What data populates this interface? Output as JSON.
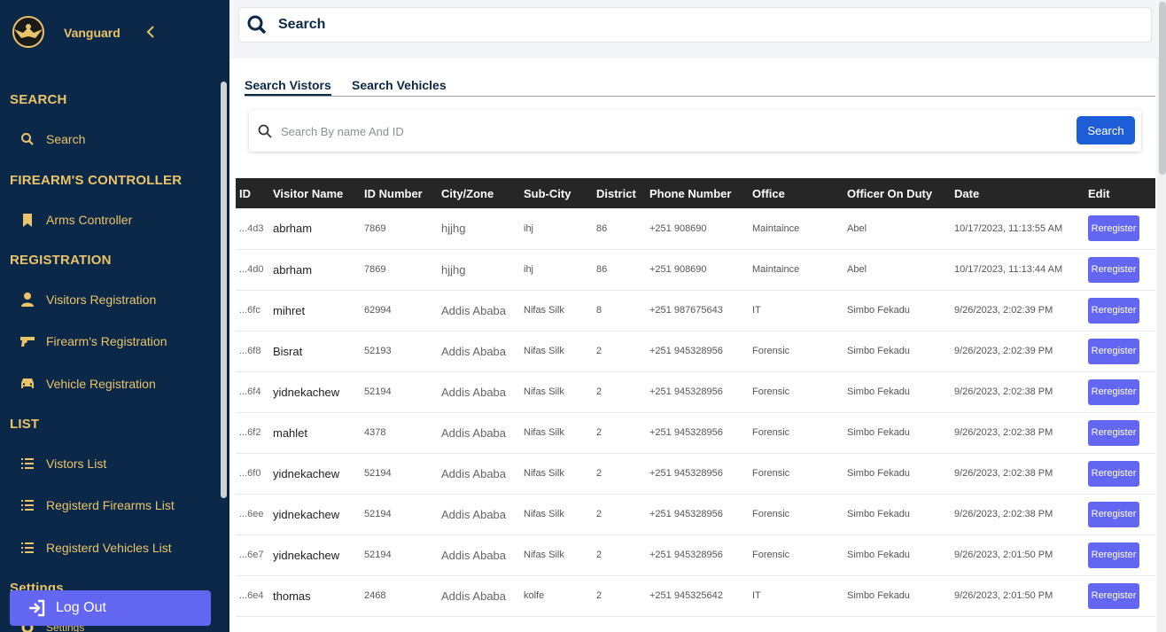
{
  "sidebar": {
    "brand": "Vanguard",
    "sections": [
      {
        "label": "SEARCH",
        "items": [
          {
            "label": "Search",
            "icon": "search-icon"
          }
        ]
      },
      {
        "label": "FIREARM'S CONTROLLER",
        "items": [
          {
            "label": "Arms Controller",
            "icon": "bookmark-icon"
          }
        ]
      },
      {
        "label": "REGISTRATION",
        "items": [
          {
            "label": "Visitors Registration",
            "icon": "user-icon"
          },
          {
            "label": "Firearm's Registration",
            "icon": "gun-icon"
          },
          {
            "label": "Vehicle Registration",
            "icon": "car-icon"
          }
        ]
      },
      {
        "label": "LIST",
        "items": [
          {
            "label": "Vistors List",
            "icon": "list-icon"
          },
          {
            "label": "Registerd Firearms List",
            "icon": "list-icon"
          },
          {
            "label": "Registerd Vehicles List",
            "icon": "list-icon"
          }
        ]
      },
      {
        "label": "Settings",
        "items": [
          {
            "label": "Settings",
            "icon": "gear-icon"
          }
        ]
      }
    ],
    "logout_label": "Log Out"
  },
  "top_search": {
    "label": "Search"
  },
  "tabs": [
    {
      "label": "Search Vistors",
      "active": true
    },
    {
      "label": "Search Vehicles",
      "active": false
    }
  ],
  "search": {
    "placeholder": "Search By name And ID",
    "button_label": "Search"
  },
  "table": {
    "headers": [
      "ID",
      "Visitor Name",
      "ID Number",
      "City/Zone",
      "Sub-City",
      "District",
      "Phone Number",
      "Office",
      "Officer On Duty",
      "Date",
      "Edit"
    ],
    "button_label": "Reregister",
    "rows": [
      [
        "...4d3",
        "abrham",
        "7869",
        "hjjhg",
        "ihj",
        "86",
        "+251 908690",
        "Maintaince",
        "Abel",
        "10/17/2023, 11:13:55 AM"
      ],
      [
        "...4d0",
        "abrham",
        "7869",
        "hjjhg",
        "ihj",
        "86",
        "+251 908690",
        "Maintaince",
        "Abel",
        "10/17/2023, 11:13:44 AM"
      ],
      [
        "...6fc",
        "mihret",
        "62994",
        "Addis Ababa",
        "Nifas Silk",
        "8",
        "+251 987675643",
        "IT",
        "Simbo Fekadu",
        "9/26/2023, 2:02:39 PM"
      ],
      [
        "...6f8",
        "Bisrat",
        "52193",
        "Addis Ababa",
        "Nifas Silk",
        "2",
        "+251 945328956",
        "Forensic",
        "Simbo Fekadu",
        "9/26/2023, 2:02:39 PM"
      ],
      [
        "...6f4",
        "yidnekachew",
        "52194",
        "Addis Ababa",
        "Nifas Silk",
        "2",
        "+251 945328956",
        "Forensic",
        "Simbo Fekadu",
        "9/26/2023, 2:02:38 PM"
      ],
      [
        "...6f2",
        "mahlet",
        "4378",
        "Addis Ababa",
        "Nifas Silk",
        "2",
        "+251 945328956",
        "Forensic",
        "Simbo Fekadu",
        "9/26/2023, 2:02:38 PM"
      ],
      [
        "...6f0",
        "yidnekachew",
        "52194",
        "Addis Ababa",
        "Nifas Silk",
        "2",
        "+251 945328956",
        "Forensic",
        "Simbo Fekadu",
        "9/26/2023, 2:02:38 PM"
      ],
      [
        "...6ee",
        "yidnekachew",
        "52194",
        "Addis Ababa",
        "Nifas Silk",
        "2",
        "+251 945328956",
        "Forensic",
        "Simbo Fekadu",
        "9/26/2023, 2:02:38 PM"
      ],
      [
        "...6e7",
        "yidnekachew",
        "52194",
        "Addis Ababa",
        "Nifas Silk",
        "2",
        "+251 945328956",
        "Forensic",
        "Simbo Fekadu",
        "9/26/2023, 2:01:50 PM"
      ],
      [
        "...6e4",
        "thomas",
        "2468",
        "Addis Ababa",
        "kolfe",
        "2",
        "+251 945325642",
        "IT",
        "Simbo Fekadu",
        "9/26/2023, 2:01:50 PM"
      ]
    ]
  },
  "colors": {
    "sidebar_bg": "#0c2848",
    "accent_gold": "#e9c46a",
    "button_purple": "#6366f1",
    "search_button_blue": "#1d5ed8",
    "table_header_bg": "#262626"
  }
}
